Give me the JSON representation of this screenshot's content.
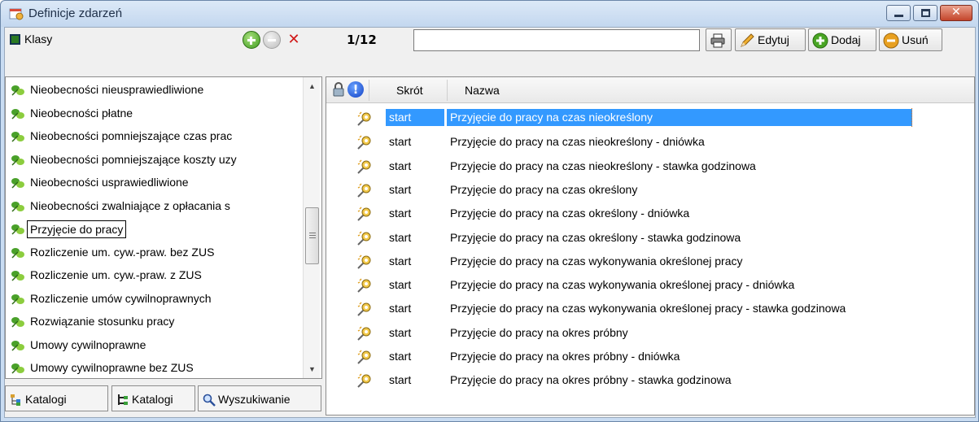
{
  "window": {
    "title": "Definicje zdarzeń"
  },
  "left": {
    "header_label": "Klasy",
    "items": [
      {
        "label": "Nieobecności nieusprawiedliwione"
      },
      {
        "label": "Nieobecności płatne"
      },
      {
        "label": "Nieobecności pomniejszające czas prac"
      },
      {
        "label": "Nieobecności pomniejszające koszty uzy"
      },
      {
        "label": "Nieobecności usprawiedliwione"
      },
      {
        "label": "Nieobecności zwalniające z opłacania s"
      },
      {
        "label": "Przyjęcie do pracy",
        "selected": true
      },
      {
        "label": "Rozliczenie um. cyw.-praw. bez ZUS"
      },
      {
        "label": "Rozliczenie um. cyw.-praw. z ZUS"
      },
      {
        "label": "Rozliczenie umów cywilnoprawnych"
      },
      {
        "label": "Rozwiązanie stosunku pracy"
      },
      {
        "label": "Umowy cywilnoprawne"
      },
      {
        "label": "Umowy cywilnoprawne bez ZUS"
      }
    ],
    "tabs": [
      {
        "label": "Katalogi"
      },
      {
        "label": "Katalogi"
      },
      {
        "label": "Wyszukiwanie"
      }
    ]
  },
  "toolbar": {
    "counter": "1/12",
    "filter_value": "",
    "edit_label": "Edytuj",
    "add_label": "Dodaj",
    "remove_label": "Usuń"
  },
  "grid": {
    "columns": {
      "shortcut": "Skrót",
      "name": "Nazwa"
    },
    "rows": [
      {
        "shortcut": "start",
        "name": "Przyjęcie do pracy na czas nieokreślony",
        "selected": true
      },
      {
        "shortcut": "start",
        "name": "Przyjęcie do pracy na czas nieokreślony - dniówka"
      },
      {
        "shortcut": "start",
        "name": "Przyjęcie do pracy na czas nieokreślony - stawka godzinowa"
      },
      {
        "shortcut": "start",
        "name": "Przyjęcie do pracy na czas określony"
      },
      {
        "shortcut": "start",
        "name": "Przyjęcie do pracy na czas określony - dniówka"
      },
      {
        "shortcut": "start",
        "name": "Przyjęcie do pracy na czas określony - stawka godzinowa"
      },
      {
        "shortcut": "start",
        "name": "Przyjęcie do pracy na czas wykonywania określonej pracy"
      },
      {
        "shortcut": "start",
        "name": "Przyjęcie do pracy na czas wykonywania określonej pracy - dniówka"
      },
      {
        "shortcut": "start",
        "name": "Przyjęcie do pracy na czas wykonywania określonej pracy - stawka godzinowa"
      },
      {
        "shortcut": "start",
        "name": "Przyjęcie do pracy na okres próbny"
      },
      {
        "shortcut": "start",
        "name": "Przyjęcie do pracy na okres próbny - dniówka"
      },
      {
        "shortcut": "start",
        "name": "Przyjęcie do pracy na okres próbny - stawka godzinowa"
      }
    ]
  },
  "colors": {
    "selection": "#3399ff",
    "window_frame": "#c9dcf2"
  }
}
